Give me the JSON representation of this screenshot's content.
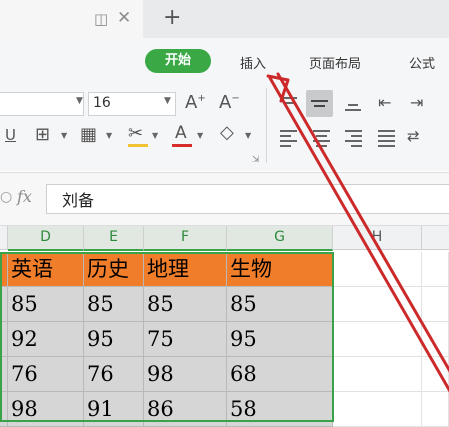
{
  "tabbar": {
    "tab_icons": [
      "window-icon",
      "close-icon"
    ],
    "new_tab_symbol": "+"
  },
  "menu": {
    "start": "开始",
    "insert": "插入",
    "page_layout": "页面布局",
    "formula": "公式"
  },
  "font": {
    "size": "16",
    "increase": "A⁺",
    "decrease": "A⁻"
  },
  "formula_bar": {
    "fx": "fx",
    "value": "刘备"
  },
  "sheet": {
    "columns": [
      "D",
      "E",
      "F",
      "G",
      "H"
    ],
    "headers": [
      "英语",
      "历史",
      "地理",
      "生物"
    ],
    "rows": [
      [
        "85",
        "85",
        "85",
        "85"
      ],
      [
        "92",
        "95",
        "75",
        "95"
      ],
      [
        "76",
        "76",
        "98",
        "68"
      ],
      [
        "98",
        "91",
        "86",
        "58"
      ]
    ]
  },
  "colors": {
    "accent": "#39a845",
    "header_fill": "#f07d29",
    "arrow": "#cc2a2a"
  }
}
